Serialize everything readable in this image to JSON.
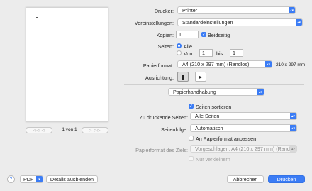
{
  "preview": {
    "page_indicator": "1 von 1",
    "prev_nav": "◁◁ ◁",
    "next_nav": "▷ ▷▷"
  },
  "printer": {
    "label": "Drucker:",
    "value": "Printer"
  },
  "presets": {
    "label": "Voreinstellungen:",
    "value": "Standardeinstellungen"
  },
  "copies": {
    "label": "Kopien:",
    "value": "1",
    "duplex_label": "Beidseitig",
    "duplex_checked": true
  },
  "pages": {
    "label": "Seiten:",
    "all_label": "Alle",
    "from_label": "Von:",
    "from_value": "1",
    "to_label": "bis:",
    "to_value": "1"
  },
  "paper_size": {
    "label": "Papierformat:",
    "value": "A4 (210 x 297 mm) (Randlos)",
    "dims": "210 x 297 mm"
  },
  "orientation": {
    "label": "Ausrichtung:"
  },
  "section": {
    "value": "Papierhandhabung"
  },
  "collate": {
    "label": "Seiten sortieren",
    "checked": true
  },
  "pages_to_print": {
    "label": "Zu druckende Seiten:",
    "value": "Alle Seiten"
  },
  "page_order": {
    "label": "Seitenfolge:",
    "value": "Automatisch"
  },
  "scale_to_fit": {
    "label": "An Papierformat anpassen",
    "checked": false
  },
  "dest_paper": {
    "label": "Papierformat des Ziels:",
    "value": "Vorgeschlagen: A4 (210 x 297 mm) (Rand..."
  },
  "scale_down_only": {
    "label": "Nur verkleinern"
  },
  "footer": {
    "help": "?",
    "pdf": "PDF",
    "details": "Details ausblenden",
    "cancel": "Abbrechen",
    "print": "Drucken"
  },
  "colors": {
    "accent": "#3b7cf5",
    "background": "#ececec"
  }
}
